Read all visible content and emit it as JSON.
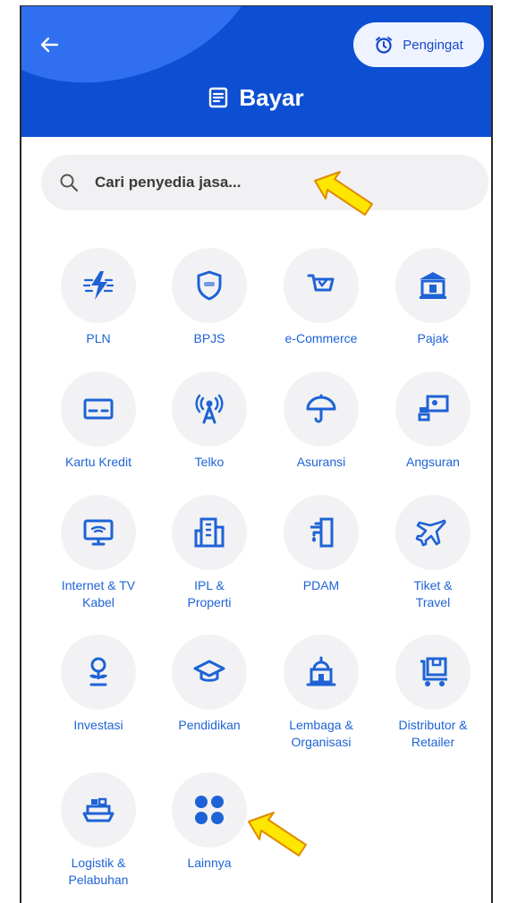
{
  "header": {
    "title": "Bayar",
    "reminder_label": "Pengingat",
    "bg_color": "#0d4fd3"
  },
  "search": {
    "placeholder": "Cari penyedia jasa..."
  },
  "categories": [
    {
      "label": "PLN",
      "icon": "electricity-icon"
    },
    {
      "label": "BPJS",
      "icon": "shield-icon"
    },
    {
      "label": "e-Commerce",
      "icon": "cart-icon"
    },
    {
      "label": "Pajak",
      "icon": "bank-icon"
    },
    {
      "label": "Kartu Kredit",
      "icon": "credit-card-icon"
    },
    {
      "label": "Telko",
      "icon": "antenna-icon"
    },
    {
      "label": "Asuransi",
      "icon": "umbrella-icon"
    },
    {
      "label": "Angsuran",
      "icon": "installment-icon"
    },
    {
      "label": "Internet & TV\nKabel",
      "icon": "monitor-icon"
    },
    {
      "label": "IPL &\nProperti",
      "icon": "building-icon"
    },
    {
      "label": "PDAM",
      "icon": "water-tap-icon"
    },
    {
      "label": "Tiket &\nTravel",
      "icon": "airplane-icon"
    },
    {
      "label": "Investasi",
      "icon": "investment-icon"
    },
    {
      "label": "Pendidikan",
      "icon": "graduation-cap-icon"
    },
    {
      "label": "Lembaga &\nOrganisasi",
      "icon": "institution-icon"
    },
    {
      "label": "Distributor &\nRetailer",
      "icon": "trolley-icon"
    },
    {
      "label": "Logistik &\nPelabuhan",
      "icon": "ship-icon"
    },
    {
      "label": "Lainnya",
      "icon": "grid-icon"
    }
  ],
  "colors": {
    "accent": "#1e63d6",
    "icon_bg": "#f2f2f4",
    "annotation_arrow": "#ffe600"
  }
}
